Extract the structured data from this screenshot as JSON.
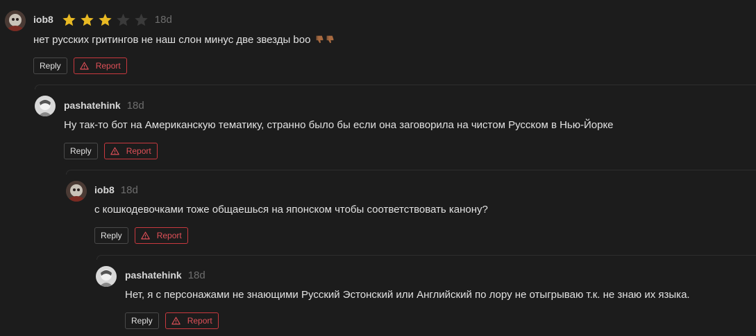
{
  "colors": {
    "accent_star": "#e8b923",
    "report_red": "#e05058",
    "bg": "#1c1c1c"
  },
  "actions": {
    "reply_label": "Reply",
    "report_label": "Report"
  },
  "comments": [
    {
      "username": "iob8",
      "time": "18d",
      "rating": 3,
      "rating_max": 5,
      "text": "нет русских гритингов не наш слон минус две звезды boo",
      "emojis": [
        "thumbs-down-icon",
        "thumbs-down-icon"
      ]
    },
    {
      "username": "pashatehink",
      "time": "18d",
      "text": "Ну так-то бот на Американскую тематику, странно было бы если она заговорила на чистом Русском в Нью-Йорке"
    },
    {
      "username": "iob8",
      "time": "18d",
      "text": "с кошкодевочками тоже общаешься на японском чтобы соответствовать канону?"
    },
    {
      "username": "pashatehink",
      "time": "18d",
      "text": "Нет, я с персонажами не знающими Русский Эстонский или Английский по лору не отыгрываю т.к. не знаю их языка."
    }
  ]
}
